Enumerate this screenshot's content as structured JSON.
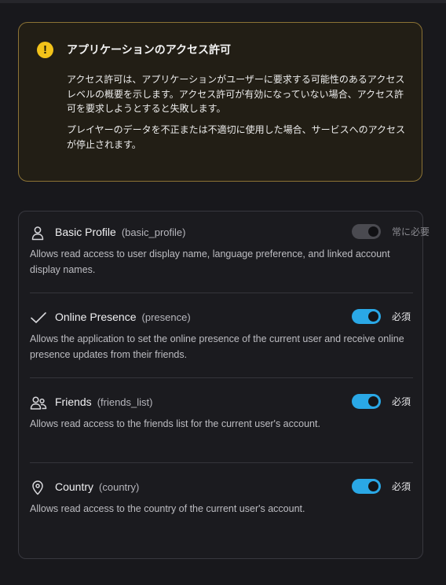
{
  "notice": {
    "title": "アプリケーションのアクセス許可",
    "paragraph_1": "アクセス許可は、アプリケーションがユーザーに要求する可能性のあるアクセスレベルの概要を示します。アクセス許可が有効になっていない場合、アクセス許可を要求しようとすると失敗します。",
    "paragraph_2": "プレイヤーのデータを不正または不適切に使用した場合、サービスへのアクセスが停止されます。",
    "icon": "warning-icon",
    "accent_color": "#f2c21a"
  },
  "permissions": [
    {
      "name": "Basic Profile",
      "key": "(basic_profile)",
      "description": "Allows read access to user display name, language preference, and linked account display names.",
      "icon": "user-icon",
      "enabled": true,
      "locked": true,
      "requirement": "常に必要"
    },
    {
      "name": "Online Presence",
      "key": "(presence)",
      "description": "Allows the application to set the online presence of the current user and receive online presence updates from their friends.",
      "icon": "checkmark-icon",
      "enabled": true,
      "locked": false,
      "requirement": "必須"
    },
    {
      "name": "Friends",
      "key": "(friends_list)",
      "description": "Allows read access to the friends list for the current user's account.",
      "icon": "users-icon",
      "enabled": true,
      "locked": false,
      "requirement": "必須"
    },
    {
      "name": "Country",
      "key": "(country)",
      "description": "Allows read access to the country of the current user's account.",
      "icon": "location-pin-icon",
      "enabled": true,
      "locked": false,
      "requirement": "必須"
    }
  ],
  "colors": {
    "toggle_on": "#2aa8e6",
    "toggle_disabled": "#4a4a50"
  }
}
